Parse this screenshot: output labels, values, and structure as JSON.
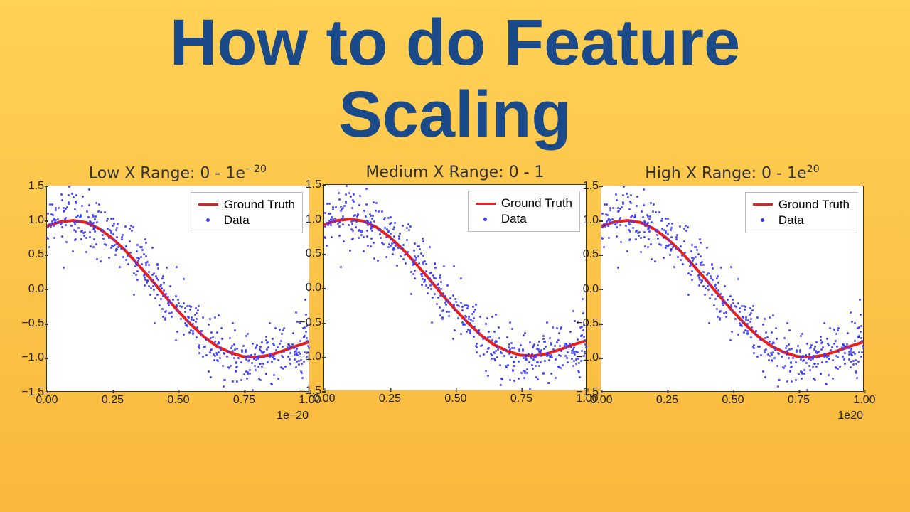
{
  "title_line1": "How to do Feature",
  "title_line2": "Scaling",
  "yticks": [
    "1.5",
    "1.0",
    "0.5",
    "0.0",
    "−0.5",
    "−1.0",
    "−1.5"
  ],
  "xticks": [
    "0.00",
    "0.25",
    "0.50",
    "0.75",
    "1.00"
  ],
  "legend": {
    "truth": "Ground Truth",
    "data": "Data"
  },
  "charts": [
    {
      "title_html": "Low X Range: 0 - 1e<sup>−20</sup>",
      "xexp": "1e−20"
    },
    {
      "title_html": "Medium X Range: 0 - 1",
      "xexp": ""
    },
    {
      "title_html": "High X Range: 0 - 1e<sup>20</sup>",
      "xexp": "1e20"
    }
  ],
  "chart_data": {
    "type": "scatter+line",
    "note": "Three identical panels differing only in x-axis scale label",
    "ylim": [
      -1.5,
      1.5
    ],
    "xlim": [
      0,
      1
    ],
    "yticks": [
      -1.5,
      -1.0,
      -0.5,
      0.0,
      0.5,
      1.0,
      1.5
    ],
    "xticks": [
      0.0,
      0.25,
      0.5,
      0.75,
      1.0
    ],
    "series": [
      {
        "name": "Ground Truth",
        "kind": "line",
        "formula": "approx sin(x*pi*~1.1 + 0.4) shape; visually cos-like descending S-curve",
        "x": [
          0.0,
          0.05,
          0.1,
          0.15,
          0.2,
          0.25,
          0.3,
          0.35,
          0.4,
          0.45,
          0.5,
          0.55,
          0.6,
          0.65,
          0.7,
          0.75,
          0.8,
          0.85,
          0.9,
          0.95,
          1.0
        ],
        "y": [
          0.92,
          0.98,
          1.0,
          0.97,
          0.88,
          0.74,
          0.56,
          0.35,
          0.13,
          -0.1,
          -0.32,
          -0.52,
          -0.7,
          -0.84,
          -0.93,
          -0.99,
          -1.0,
          -0.97,
          -0.91,
          -0.84,
          -0.78
        ]
      },
      {
        "name": "Data",
        "kind": "scatter",
        "description": "~500 points, Ground Truth + N(0,~0.25)"
      }
    ],
    "panels": [
      {
        "title": "Low X Range: 0 - 1e^-20",
        "x_scale_label": "1e-20"
      },
      {
        "title": "Medium X Range: 0 - 1",
        "x_scale_label": ""
      },
      {
        "title": "High X Range: 0 - 1e^20",
        "x_scale_label": "1e20"
      }
    ],
    "legend": [
      "Ground Truth",
      "Data"
    ]
  }
}
